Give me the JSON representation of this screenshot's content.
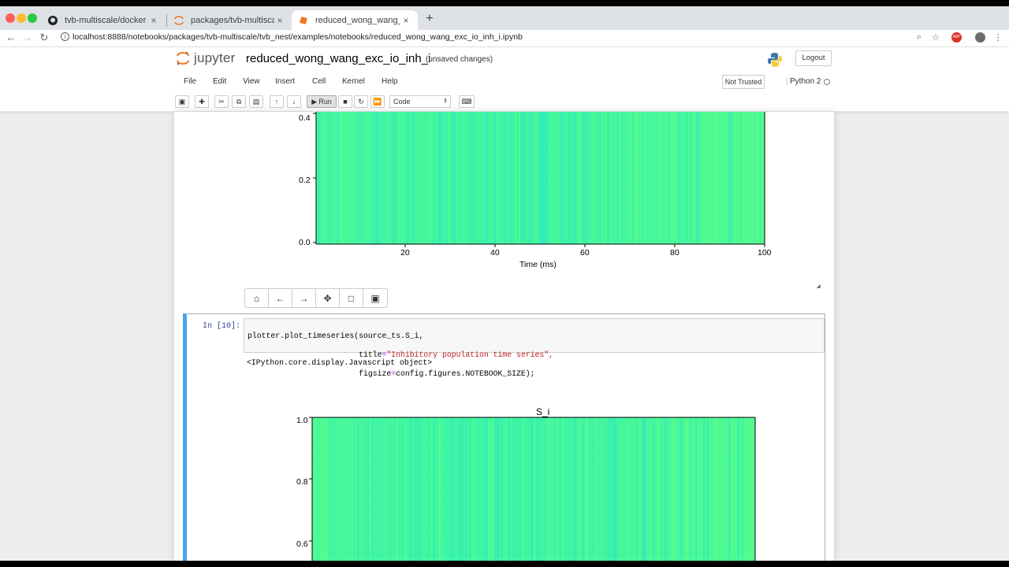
{
  "browser": {
    "tabs": [
      {
        "title": "tvb-multiscale/docker at maste",
        "icon": "github-icon"
      },
      {
        "title": "packages/tvb-multiscale/tvb_n",
        "icon": "jupyter-icon"
      },
      {
        "title": "reduced_wong_wang_exc_io_in",
        "icon": "jupyter-icon"
      }
    ],
    "url": "localhost:8888/notebooks/packages/tvb-multiscale/tvb_nest/examples/notebooks/reduced_wong_wang_exc_io_inh_i.ipynb",
    "extension_label": "ABP"
  },
  "jupyter": {
    "logo_text": "jupyter",
    "notebook_title": "reduced_wong_wang_exc_io_inh_i",
    "save_status": "(unsaved changes)",
    "logout_label": "Logout",
    "menu": [
      "File",
      "Edit",
      "View",
      "Insert",
      "Cell",
      "Kernel",
      "Help"
    ],
    "trust_label": "Not Trusted",
    "kernel_name": "Python 2",
    "run_label": "Run",
    "cell_type": "Code"
  },
  "plot_top": {
    "ylabel_ticks": [
      "0.4",
      "0.2",
      "0.0"
    ],
    "xticks": [
      "20",
      "40",
      "60",
      "80",
      "100"
    ],
    "xlabel": "Time (ms)"
  },
  "cell10": {
    "prompt": "In [10]:",
    "code_lines": [
      [
        "plotter.plot_timeseries(source_ts.S_i,",
        "",
        ""
      ],
      [
        "                        title",
        "=",
        "\"Inhibitory population time series\","
      ],
      [
        "                        figsize",
        "=",
        "config.figures.NOTEBOOK_SIZE);"
      ]
    ],
    "output_text": "<IPython.core.display.Javascript object>"
  },
  "plot_bottom": {
    "title": "S_i",
    "yticks": [
      "1.0",
      "0.8",
      "0.6"
    ]
  },
  "colors": {
    "heatmap_base": "#4dfc93",
    "heatmap_streak": "#2ee8c0",
    "cell_selected": "#42a5f5"
  }
}
